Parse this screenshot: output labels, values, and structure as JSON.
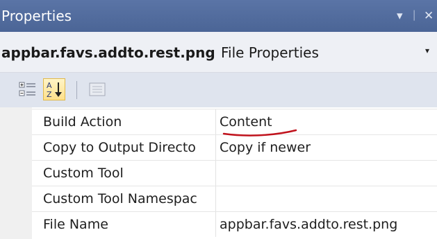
{
  "panel": {
    "title": "Properties",
    "controls": {
      "dropdown_icon": "▾",
      "pin_icon": "ᛁ",
      "close_icon": "✕"
    }
  },
  "object_selector": {
    "name": "appbar.favs.addto.rest.png",
    "type": "File Properties",
    "dropdown_icon": "▾"
  },
  "toolbar": {
    "buttons": [
      {
        "icon": "categorized-icon",
        "active": false
      },
      {
        "icon": "alphabetical-sort-icon",
        "active": true
      },
      {
        "icon": "property-pages-icon",
        "active": false
      }
    ]
  },
  "properties": [
    {
      "name": "Build Action",
      "value": "Content"
    },
    {
      "name": "Copy to Output Directo",
      "value": "Copy if newer"
    },
    {
      "name": "Custom Tool",
      "value": ""
    },
    {
      "name": "Custom Tool Namespac",
      "value": ""
    },
    {
      "name": "File Name",
      "value": "appbar.favs.addto.rest.png"
    }
  ],
  "annotation": {
    "color": "#c0121c",
    "target": "Build Action value"
  }
}
